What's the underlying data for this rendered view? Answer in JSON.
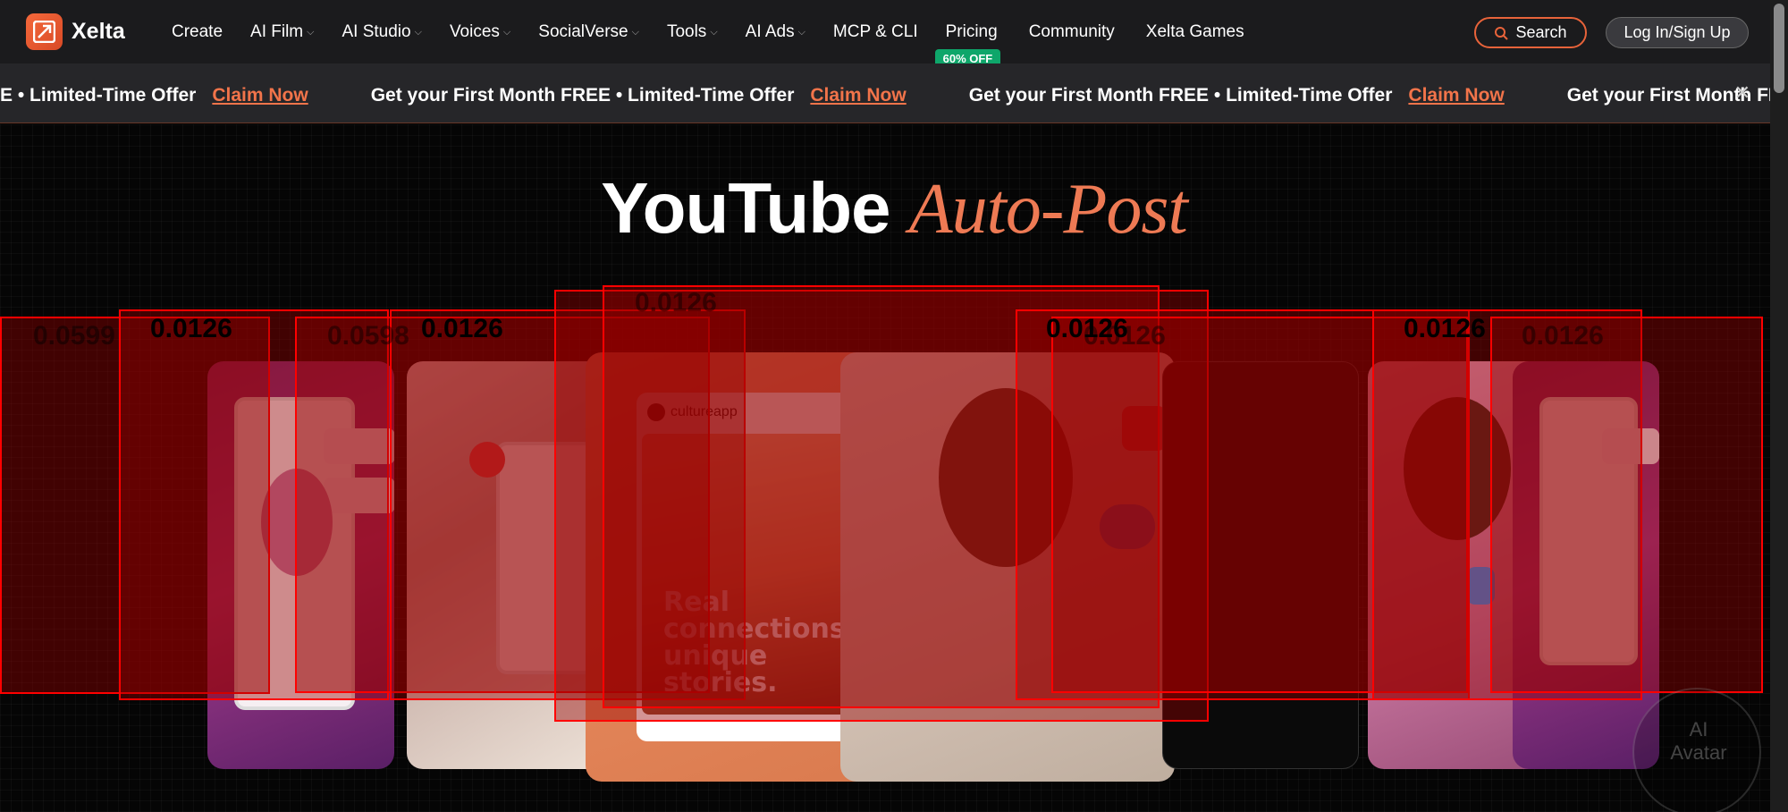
{
  "brand": {
    "name": "Xelta",
    "accent": "#e8633a",
    "badge_color": "#0ea66a"
  },
  "nav": {
    "items": [
      {
        "label": "Create",
        "dropdown": false
      },
      {
        "label": "AI Film",
        "dropdown": true
      },
      {
        "label": "AI Studio",
        "dropdown": true
      },
      {
        "label": "Voices",
        "dropdown": true
      },
      {
        "label": "SocialVerse",
        "dropdown": true
      },
      {
        "label": "Tools",
        "dropdown": true
      },
      {
        "label": "AI Ads",
        "dropdown": true
      },
      {
        "label": "MCP & CLI",
        "dropdown": false
      },
      {
        "label": "Pricing",
        "dropdown": false,
        "badge": "60% OFF"
      },
      {
        "label": "Community",
        "dropdown": false
      },
      {
        "label": "Xelta Games",
        "dropdown": false
      }
    ],
    "search_label": "Search",
    "login_label": "Log In/Sign Up"
  },
  "promo": {
    "text": "Get your First Month FREE • Limited-Time Offer",
    "cta": "Claim Now",
    "partial_lead": "E • Limited-Time Offer",
    "trailing": "Get your First Month FREE",
    "close_icon": "close-icon"
  },
  "hero": {
    "title_main": "YouTube",
    "title_accent": "Auto-Post"
  },
  "cards": {
    "post_brand": "cultureapp",
    "post_caption_1": "Real",
    "post_caption_2": "connections,",
    "post_caption_3": "unique stories."
  },
  "detections": {
    "labels": [
      "0.0599",
      "0.0126",
      "0.0598",
      "0.0126",
      "0.0126",
      "0.0126",
      "0.0126",
      "0.0126",
      "0.0126"
    ]
  },
  "avatar": {
    "line1": "AI",
    "line2": "Avatar"
  }
}
